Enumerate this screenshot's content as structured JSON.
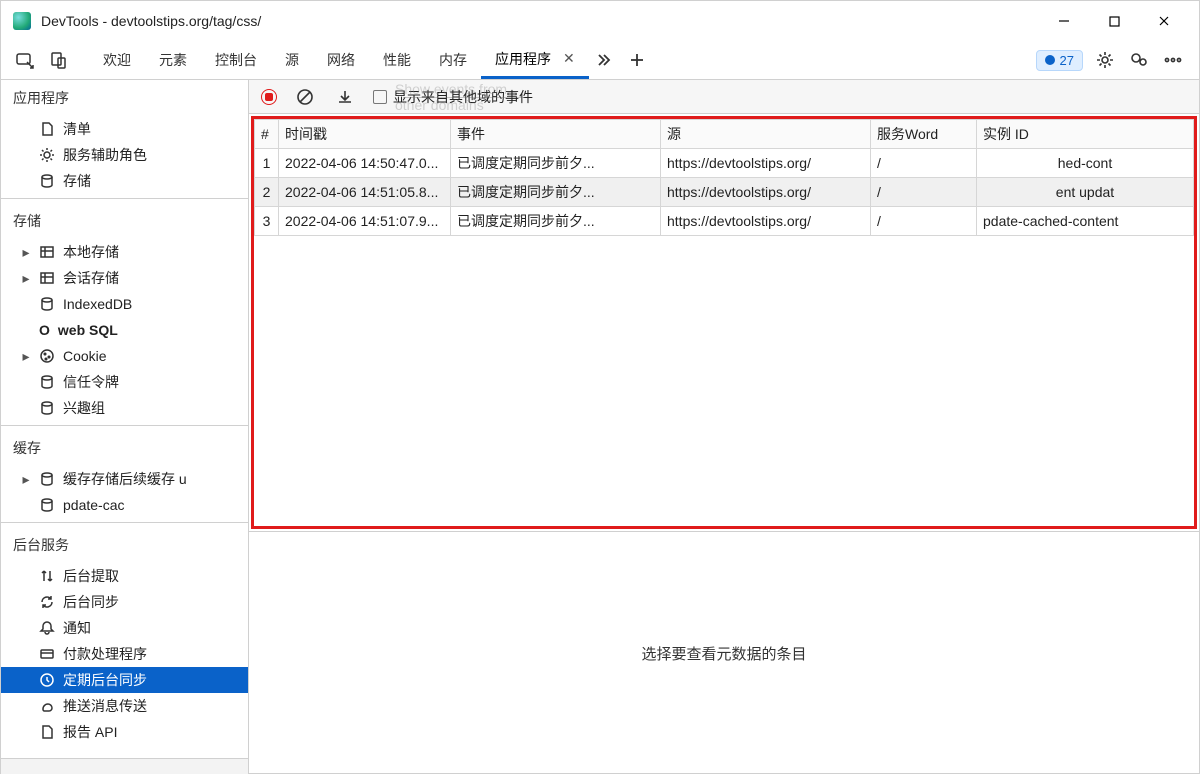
{
  "window": {
    "title": "DevTools - devtoolstips.org/tag/css/"
  },
  "tabs": {
    "items": [
      "欢迎",
      "元素",
      "控制台",
      "源",
      "网络",
      "性能",
      "内存",
      "应用程序"
    ],
    "active_index": 7,
    "issue_count": "27"
  },
  "toolbar": {
    "checkbox_label": "显示来自其他域的事件",
    "strike_text": "Show events from other domains"
  },
  "sidebar": {
    "app": {
      "title": "应用程序",
      "items": [
        "清单",
        "服务辅助角色",
        "存储"
      ]
    },
    "storage": {
      "title": "存储",
      "items": [
        "本地存储",
        "会话存储",
        "IndexedDB",
        "web SQL",
        "Cookie",
        "信任令牌",
        "兴趣组"
      ]
    },
    "cache": {
      "title": "缓存",
      "items": [
        "缓存存储后续缓存 u",
        "pdate-cac"
      ]
    },
    "bg": {
      "title": "后台服务",
      "items": [
        "后台提取",
        "后台同步",
        "通知",
        "付款处理程序",
        "定期后台同步",
        "推送消息传送",
        "报告 API"
      ]
    }
  },
  "table": {
    "headers": {
      "idx": "#",
      "time": "时间戳",
      "event": "事件",
      "source": "源",
      "sw": "服务Word",
      "instance": "实例 ID"
    },
    "rows": [
      {
        "idx": "1",
        "time": "2022-04-06 14:50:47.0...",
        "event": "已调度定期同步前夕...",
        "source": "https://devtoolstips.org/",
        "sw": "/",
        "instance": "hed-cont"
      },
      {
        "idx": "2",
        "time": "2022-04-06 14:51:05.8...",
        "event": "已调度定期同步前夕...",
        "source": "https://devtoolstips.org/",
        "sw": "/",
        "instance": "ent updat"
      },
      {
        "idx": "3",
        "time": "2022-04-06 14:51:07.9...",
        "event": "已调度定期同步前夕...",
        "source": "https://devtoolstips.org/",
        "sw": "/",
        "instance": "pdate-cached-content"
      }
    ]
  },
  "detail": {
    "placeholder": "选择要查看元数据的条目"
  }
}
